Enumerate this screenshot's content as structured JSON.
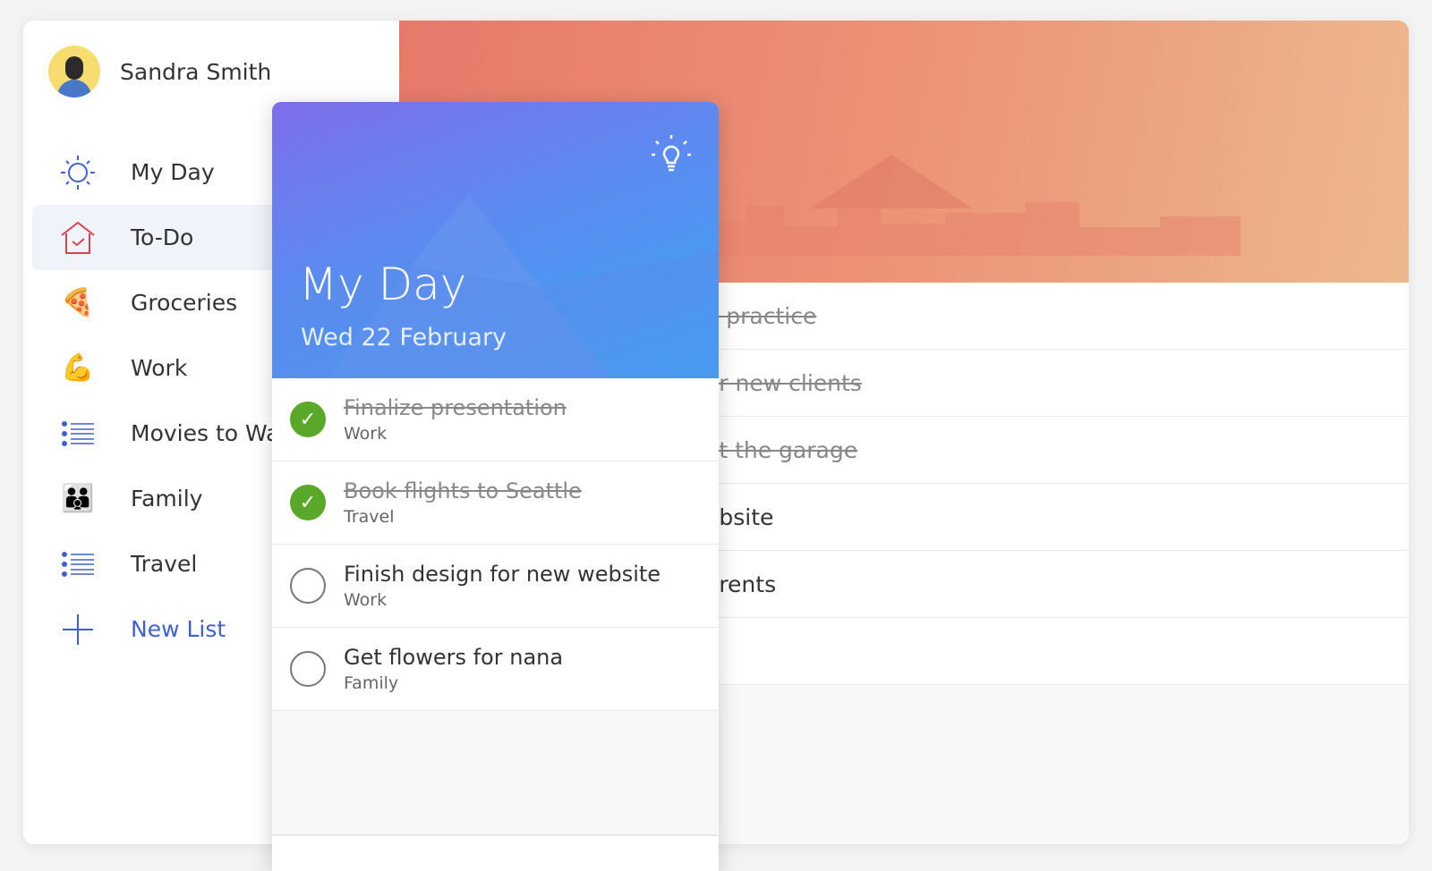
{
  "user": {
    "name": "Sandra Smith"
  },
  "sidebar": {
    "items": [
      {
        "label": "My Day",
        "icon": "sun-icon"
      },
      {
        "label": "To-Do",
        "icon": "house-check-icon",
        "active": true
      },
      {
        "label": "Groceries",
        "icon": "pizza-icon"
      },
      {
        "label": "Work",
        "icon": "flexed-biceps-icon"
      },
      {
        "label": "Movies to Wat",
        "icon": "list-icon"
      },
      {
        "label": "Family",
        "icon": "family-icon"
      },
      {
        "label": "Travel",
        "icon": "list-icon"
      },
      {
        "label": "New List",
        "icon": "plus-icon"
      }
    ]
  },
  "background_list": [
    {
      "text": "o practice",
      "done": true
    },
    {
      "text": "or new clients",
      "done": true
    },
    {
      "text": "at the garage",
      "done": true
    },
    {
      "text": "ebsite",
      "done": false
    },
    {
      "text": "arents",
      "done": false
    },
    {
      "text": "",
      "done": false
    }
  ],
  "myday": {
    "title": "My Day",
    "date": "Wed 22 February",
    "tasks": [
      {
        "title": "Finalize presentation",
        "list": "Work",
        "done": true
      },
      {
        "title": "Book flights to Seattle",
        "list": "Travel",
        "done": true
      },
      {
        "title": "Finish design for new website",
        "list": "Work",
        "done": false
      },
      {
        "title": "Get flowers for nana",
        "list": "Family",
        "done": false
      }
    ]
  },
  "colors": {
    "accent": "#3f5fd4",
    "check": "#5aa829",
    "todo_red": "#d9434a"
  }
}
